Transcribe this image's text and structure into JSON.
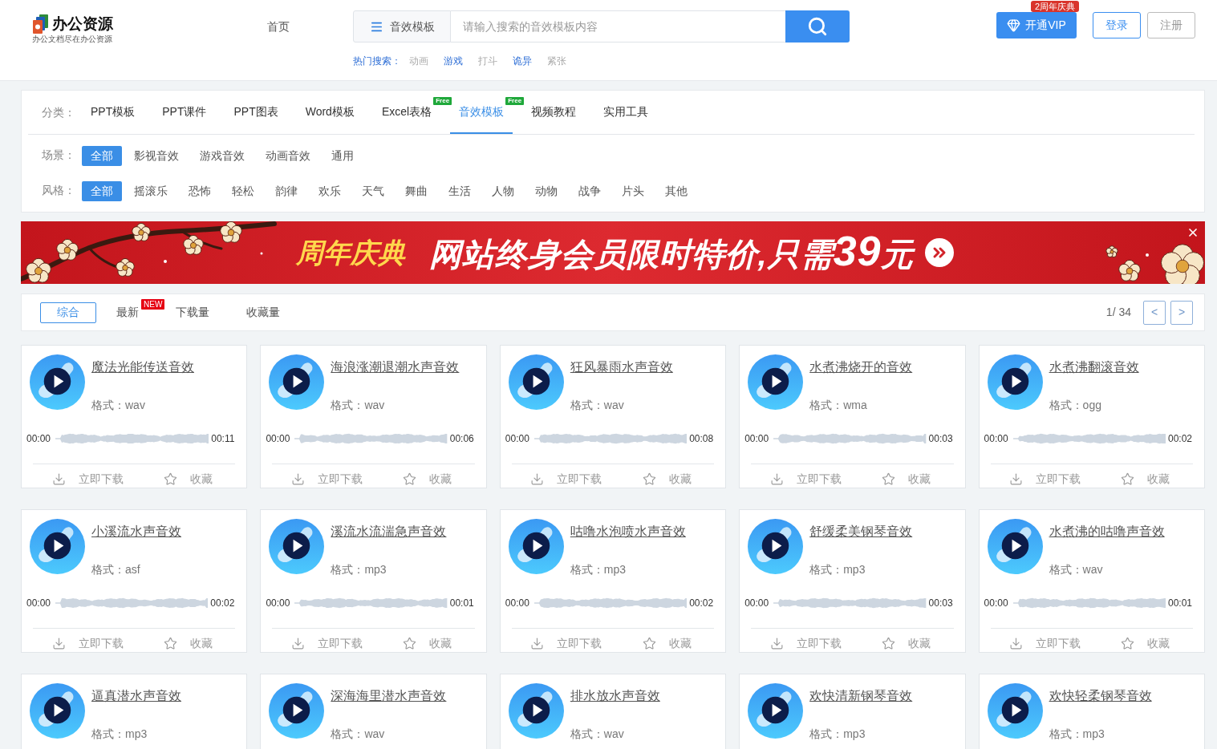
{
  "header": {
    "logo": {
      "name": "办公资源",
      "tagline": "办公文档尽在办公资源"
    },
    "nav": [
      {
        "label": "首页"
      }
    ],
    "search": {
      "category": "音效模板",
      "placeholder": "请输入搜索的音效模板内容"
    },
    "hot_searches": {
      "label": "热门搜索：",
      "items": [
        {
          "text": "动画",
          "highlighted": false
        },
        {
          "text": "游戏",
          "highlighted": true
        },
        {
          "text": "打斗",
          "highlighted": false
        },
        {
          "text": "诡异",
          "highlighted": true
        },
        {
          "text": "紧张",
          "highlighted": false
        }
      ]
    },
    "vip_button": {
      "label": "开通VIP",
      "badge": "2周年庆典"
    },
    "login_button": "登录",
    "register_button": "注册"
  },
  "filters": {
    "category": {
      "label": "分类：",
      "items": [
        {
          "label": "PPT模板",
          "selected": false
        },
        {
          "label": "PPT课件",
          "selected": false
        },
        {
          "label": "PPT图表",
          "selected": false
        },
        {
          "label": "Word模板",
          "selected": false
        },
        {
          "label": "Excel表格",
          "selected": false,
          "badge": "Free"
        },
        {
          "label": "音效模板",
          "selected": true,
          "badge": "Free"
        },
        {
          "label": "视频教程",
          "selected": false
        },
        {
          "label": "实用工具",
          "selected": false
        }
      ]
    },
    "scene": {
      "label": "场景：",
      "items": [
        {
          "label": "全部",
          "selected": true
        },
        {
          "label": "影视音效",
          "selected": false
        },
        {
          "label": "游戏音效",
          "selected": false
        },
        {
          "label": "动画音效",
          "selected": false
        },
        {
          "label": "通用",
          "selected": false
        }
      ]
    },
    "style": {
      "label": "风格：",
      "items": [
        {
          "label": "全部",
          "selected": true
        },
        {
          "label": "摇滚乐",
          "selected": false
        },
        {
          "label": "恐怖",
          "selected": false
        },
        {
          "label": "轻松",
          "selected": false
        },
        {
          "label": "韵律",
          "selected": false
        },
        {
          "label": "欢乐",
          "selected": false
        },
        {
          "label": "天气",
          "selected": false
        },
        {
          "label": "舞曲",
          "selected": false
        },
        {
          "label": "生活",
          "selected": false
        },
        {
          "label": "人物",
          "selected": false
        },
        {
          "label": "动物",
          "selected": false
        },
        {
          "label": "战争",
          "selected": false
        },
        {
          "label": "片头",
          "selected": false
        },
        {
          "label": "其他",
          "selected": false
        }
      ]
    }
  },
  "banner": {
    "highlight": "周年庆典",
    "slogan": "网站终身会员限时特价,只需",
    "price": "39",
    "price_unit": "元"
  },
  "sort_bar": {
    "options": [
      {
        "label": "综合",
        "selected": true
      },
      {
        "label": "最新",
        "selected": false,
        "badge": "NEW"
      },
      {
        "label": "下载量",
        "selected": false
      },
      {
        "label": "收藏量",
        "selected": false
      }
    ],
    "page": "1/ 34",
    "prev": "<",
    "next": ">"
  },
  "cards": [
    {
      "title": "魔法光能传送音效",
      "format": "格式：wav",
      "start": "00:00",
      "duration": "00:11",
      "download": "立即下载",
      "favorite": "收藏"
    },
    {
      "title": "海浪涨潮退潮水声音效",
      "format": "格式：wav",
      "start": "00:00",
      "duration": "00:06",
      "download": "立即下载",
      "favorite": "收藏"
    },
    {
      "title": "狂风暴雨水声音效",
      "format": "格式：wav",
      "start": "00:00",
      "duration": "00:08",
      "download": "立即下载",
      "favorite": "收藏"
    },
    {
      "title": "水煮沸烧开的音效",
      "format": "格式：wma",
      "start": "00:00",
      "duration": "00:03",
      "download": "立即下载",
      "favorite": "收藏"
    },
    {
      "title": "水煮沸翻滚音效",
      "format": "格式：ogg",
      "start": "00:00",
      "duration": "00:02",
      "download": "立即下载",
      "favorite": "收藏"
    },
    {
      "title": "小溪流水声音效",
      "format": "格式：asf",
      "start": "00:00",
      "duration": "00:02",
      "download": "立即下载",
      "favorite": "收藏"
    },
    {
      "title": "溪流水流湍急声音效",
      "format": "格式：mp3",
      "start": "00:00",
      "duration": "00:01",
      "download": "立即下载",
      "favorite": "收藏"
    },
    {
      "title": "咕噜水泡喷水声音效",
      "format": "格式：mp3",
      "start": "00:00",
      "duration": "00:02",
      "download": "立即下载",
      "favorite": "收藏"
    },
    {
      "title": "舒缓柔美钢琴音效",
      "format": "格式：mp3",
      "start": "00:00",
      "duration": "00:03",
      "download": "立即下载",
      "favorite": "收藏"
    },
    {
      "title": "水煮沸的咕噜声音效",
      "format": "格式：wav",
      "start": "00:00",
      "duration": "00:01",
      "download": "立即下载",
      "favorite": "收藏"
    },
    {
      "title": "逼真潜水声音效",
      "format": "格式：mp3"
    },
    {
      "title": "深海海里潜水声音效",
      "format": "格式：wav"
    },
    {
      "title": "排水放水声音效",
      "format": "格式：wav"
    },
    {
      "title": "欢快清新钢琴音效",
      "format": "格式：mp3"
    },
    {
      "title": "欢快轻柔钢琴音效",
      "format": "格式：mp3"
    }
  ]
}
